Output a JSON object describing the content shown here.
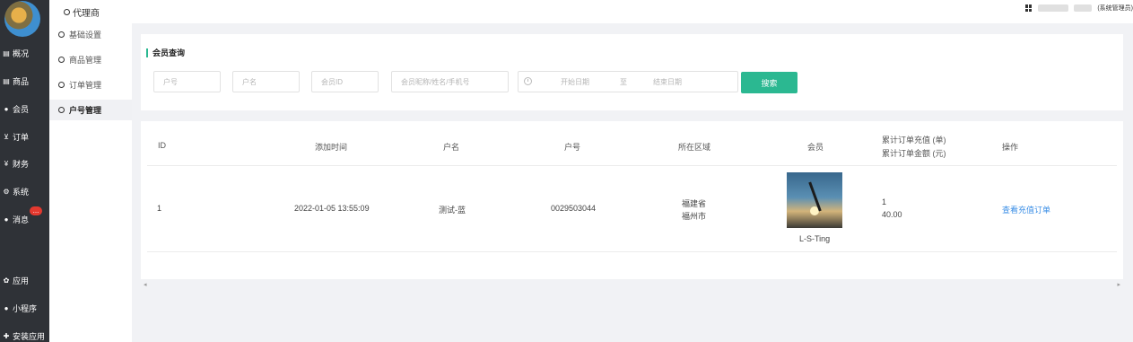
{
  "sidebar": {
    "items": [
      {
        "label": "概况",
        "icon": "dashboard-icon"
      },
      {
        "label": "商品",
        "icon": "goods-icon"
      },
      {
        "label": "会员",
        "icon": "members-icon"
      },
      {
        "label": "订单",
        "icon": "cart-icon"
      },
      {
        "label": "财务",
        "icon": "yen-icon"
      },
      {
        "label": "系统",
        "icon": "gears-icon"
      },
      {
        "label": "消息",
        "icon": "chat-icon"
      },
      {
        "label": "应用",
        "icon": "apps-icon"
      },
      {
        "label": "小程序",
        "icon": "wechat-icon"
      },
      {
        "label": "安装应用",
        "icon": "plugin-icon"
      }
    ],
    "badge": "..."
  },
  "topbar": {
    "title": "代理商",
    "role": "(系统管理员)"
  },
  "subnav": {
    "items": [
      "基础设置",
      "商品管理",
      "订单管理",
      "户号管理"
    ],
    "active_index": 3
  },
  "search": {
    "title": "会员查询",
    "placeholders": {
      "account_no": "户号",
      "account_name": "户名",
      "member_id": "会员ID",
      "keyword": "会员昵称/姓名/手机号"
    },
    "date_start": "开始日期",
    "date_sep": "至",
    "date_end": "结束日期",
    "button": "搜索"
  },
  "table": {
    "headers": {
      "id": "ID",
      "added": "添加时间",
      "name": "户名",
      "number": "户号",
      "region": "所在区域",
      "member": "会员",
      "stats_line1": "累计订单充值 (单)",
      "stats_line2": "累计订单金额 (元)",
      "action": "操作"
    },
    "rows": [
      {
        "id": "1",
        "added": "2022-01-05 13:55:09",
        "name": "测试-蓝",
        "number": "0029503044",
        "province": "福建省",
        "city": "福州市",
        "member_name": "L-S-Ting",
        "order_count": "1",
        "order_amount": "40.00",
        "action": "查看充值订单"
      }
    ]
  },
  "colors": {
    "sidebar_bg": "#2f3237",
    "accent": "#2bb891",
    "link": "#3a8ee6",
    "badge": "#e4392f"
  }
}
